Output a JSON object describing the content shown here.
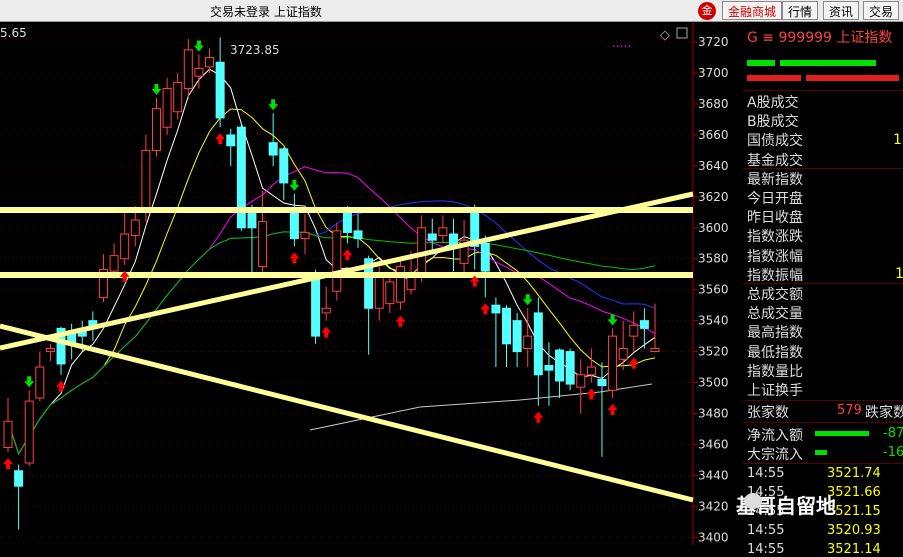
{
  "titlebar": {
    "title": "交易未登录  上证指数",
    "buttons": [
      "金融商城",
      "行情",
      "资讯",
      "交易"
    ],
    "logo_text": "金"
  },
  "chart_data": {
    "type": "candlestick",
    "top_left_value": "5.65",
    "high_label": "3723.85",
    "y_ticks": [
      3720,
      3700,
      3680,
      3660,
      3640,
      3620,
      3600,
      3580,
      3560,
      3540,
      3520,
      3500,
      3480,
      3460,
      3440,
      3420,
      3400
    ],
    "ylim": [
      3395,
      3733
    ],
    "candles": [
      {
        "o": 3458,
        "c": 3475,
        "h": 3490,
        "l": 3455
      },
      {
        "o": 3443,
        "c": 3433,
        "h": 3447,
        "l": 3405
      },
      {
        "o": 3448,
        "c": 3488,
        "h": 3495,
        "l": 3446
      },
      {
        "o": 3490,
        "c": 3510,
        "h": 3520,
        "l": 3488
      },
      {
        "o": 3520,
        "c": 3522,
        "h": 3525,
        "l": 3514
      },
      {
        "o": 3535,
        "c": 3512,
        "h": 3536,
        "l": 3505
      },
      {
        "o": 3532,
        "c": 3525,
        "h": 3538,
        "l": 3515
      },
      {
        "o": 3535,
        "c": 3530,
        "h": 3540,
        "l": 3520
      },
      {
        "o": 3540,
        "c": 3535,
        "h": 3546,
        "l": 3527
      },
      {
        "o": 3555,
        "c": 3573,
        "h": 3583,
        "l": 3552
      },
      {
        "o": 3572,
        "c": 3582,
        "h": 3590,
        "l": 3567
      },
      {
        "o": 3580,
        "c": 3596,
        "h": 3612,
        "l": 3576
      },
      {
        "o": 3595,
        "c": 3605,
        "h": 3614,
        "l": 3588
      },
      {
        "o": 3610,
        "c": 3650,
        "h": 3660,
        "l": 3604
      },
      {
        "o": 3650,
        "c": 3677,
        "h": 3684,
        "l": 3646
      },
      {
        "o": 3665,
        "c": 3690,
        "h": 3697,
        "l": 3660
      },
      {
        "o": 3675,
        "c": 3694,
        "h": 3700,
        "l": 3670
      },
      {
        "o": 3690,
        "c": 3715,
        "h": 3722,
        "l": 3683
      },
      {
        "o": 3698,
        "c": 3703,
        "h": 3712,
        "l": 3690
      },
      {
        "o": 3704,
        "c": 3710,
        "h": 3716,
        "l": 3700
      },
      {
        "o": 3707,
        "c": 3671,
        "h": 3723,
        "l": 3665
      },
      {
        "o": 3660,
        "c": 3653,
        "h": 3664,
        "l": 3640
      },
      {
        "o": 3665,
        "c": 3600,
        "h": 3668,
        "l": 3598
      },
      {
        "o": 3610,
        "c": 3600,
        "h": 3615,
        "l": 3570
      },
      {
        "o": 3575,
        "c": 3604,
        "h": 3624,
        "l": 3568
      },
      {
        "o": 3655,
        "c": 3647,
        "h": 3674,
        "l": 3640
      },
      {
        "o": 3651,
        "c": 3629,
        "h": 3652,
        "l": 3618
      },
      {
        "o": 3613,
        "c": 3593,
        "h": 3622,
        "l": 3588
      },
      {
        "o": 3593,
        "c": 3597,
        "h": 3609,
        "l": 3583
      },
      {
        "o": 3570,
        "c": 3530,
        "h": 3573,
        "l": 3525
      },
      {
        "o": 3545,
        "c": 3548,
        "h": 3562,
        "l": 3540
      },
      {
        "o": 3559,
        "c": 3598,
        "h": 3603,
        "l": 3553
      },
      {
        "o": 3610,
        "c": 3597,
        "h": 3614,
        "l": 3590
      },
      {
        "o": 3598,
        "c": 3593,
        "h": 3609,
        "l": 3587
      },
      {
        "o": 3580,
        "c": 3548,
        "h": 3582,
        "l": 3518
      },
      {
        "o": 3548,
        "c": 3568,
        "h": 3575,
        "l": 3540
      },
      {
        "o": 3551,
        "c": 3565,
        "h": 3570,
        "l": 3545
      },
      {
        "o": 3552,
        "c": 3575,
        "h": 3580,
        "l": 3547
      },
      {
        "o": 3560,
        "c": 3570,
        "h": 3585,
        "l": 3557
      },
      {
        "o": 3570,
        "c": 3600,
        "h": 3608,
        "l": 3565
      },
      {
        "o": 3596,
        "c": 3592,
        "h": 3606,
        "l": 3583
      },
      {
        "o": 3595,
        "c": 3600,
        "h": 3608,
        "l": 3590
      },
      {
        "o": 3596,
        "c": 3588,
        "h": 3606,
        "l": 3572
      },
      {
        "o": 3577,
        "c": 3592,
        "h": 3605,
        "l": 3570
      },
      {
        "o": 3613,
        "c": 3588,
        "h": 3615,
        "l": 3573
      },
      {
        "o": 3590,
        "c": 3572,
        "h": 3595,
        "l": 3555
      },
      {
        "o": 3550,
        "c": 3545,
        "h": 3555,
        "l": 3510
      },
      {
        "o": 3548,
        "c": 3525,
        "h": 3550,
        "l": 3510
      },
      {
        "o": 3540,
        "c": 3520,
        "h": 3545,
        "l": 3510
      },
      {
        "o": 3522,
        "c": 3530,
        "h": 3548,
        "l": 3510
      },
      {
        "o": 3545,
        "c": 3505,
        "h": 3555,
        "l": 3485
      },
      {
        "o": 3511,
        "c": 3508,
        "h": 3526,
        "l": 3485
      },
      {
        "o": 3521,
        "c": 3501,
        "h": 3522,
        "l": 3490
      },
      {
        "o": 3520,
        "c": 3499,
        "h": 3522,
        "l": 3495
      },
      {
        "o": 3497,
        "c": 3505,
        "h": 3515,
        "l": 3480
      },
      {
        "o": 3505,
        "c": 3510,
        "h": 3522,
        "l": 3500
      },
      {
        "o": 3502,
        "c": 3498,
        "h": 3513,
        "l": 3452
      },
      {
        "o": 3495,
        "c": 3530,
        "h": 3535,
        "l": 3490
      },
      {
        "o": 3515,
        "c": 3522,
        "h": 3540,
        "l": 3508
      },
      {
        "o": 3530,
        "c": 3537,
        "h": 3546,
        "l": 3520
      },
      {
        "o": 3540,
        "c": 3535,
        "h": 3548,
        "l": 3522
      },
      {
        "o": 3520,
        "c": 3522,
        "h": 3551,
        "l": 3520
      }
    ],
    "colors": {
      "up": "#ff4040",
      "down": "#54ffff",
      "support": "#ffff99",
      "ma_white": "#ffffff",
      "ma_yellow": "#ffff00",
      "ma_magenta": "#ff00ff",
      "ma_green": "#00c000",
      "ma_blue": "#3030ff",
      "ma_gray": "#c8c8c8"
    }
  },
  "panel": {
    "code_line": "G  ≡  999999  上证指数",
    "labels": [
      "A股成交",
      "B股成交",
      "国债成交",
      "基金成交",
      "最新指数",
      "今日开盘",
      "昨日收盘",
      "指数涨跌",
      "指数涨幅",
      "指数振幅",
      "总成交额",
      "总成交量",
      "最高指数",
      "最低指数",
      "指数量比",
      "上证换手"
    ],
    "guozhai_suffix": "1",
    "zhenfu_suffix": "1",
    "up_label": "张家数",
    "up_count": "579",
    "down_label": "跌家数",
    "flow_label": "净流入额",
    "flow_value": "-87",
    "bulk_label": "大宗流入",
    "bulk_value": "-16",
    "ticks": [
      {
        "time": "14:55",
        "price": "3521.74"
      },
      {
        "time": "14:55",
        "price": "3521.66"
      },
      {
        "time": "14:55",
        "price": "3521.15"
      },
      {
        "time": "14:55",
        "price": "3520.93"
      },
      {
        "time": "14:55",
        "price": "3521.14"
      }
    ],
    "watermark": "基哥自留地"
  }
}
